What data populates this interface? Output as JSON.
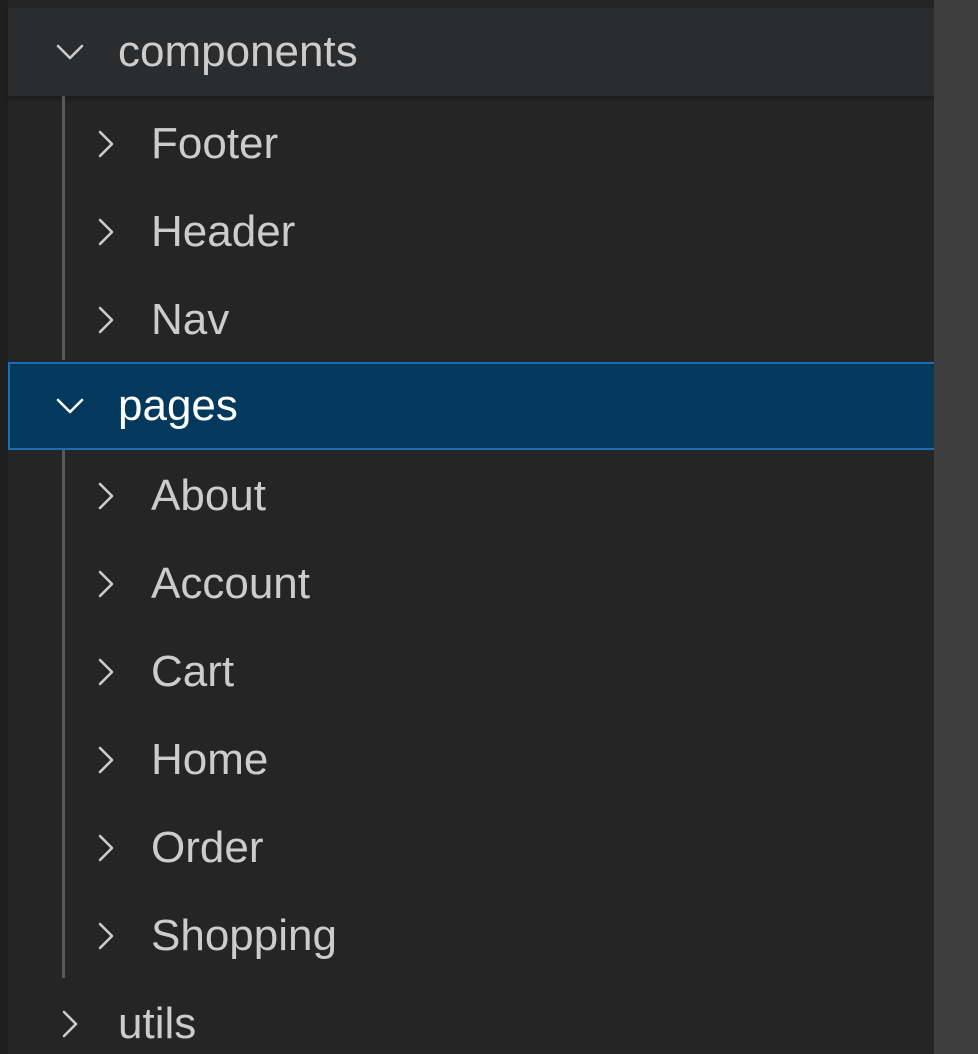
{
  "explorer": {
    "tree": [
      {
        "label": "components",
        "expanded": true,
        "level": 0,
        "children": [
          {
            "label": "Footer",
            "expanded": false
          },
          {
            "label": "Header",
            "expanded": false
          },
          {
            "label": "Nav",
            "expanded": false
          }
        ]
      },
      {
        "label": "pages",
        "expanded": true,
        "level": 0,
        "selected": true,
        "children": [
          {
            "label": "About",
            "expanded": false
          },
          {
            "label": "Account",
            "expanded": false
          },
          {
            "label": "Cart",
            "expanded": false
          },
          {
            "label": "Home",
            "expanded": false
          },
          {
            "label": "Order",
            "expanded": false
          },
          {
            "label": "Shopping",
            "expanded": false
          }
        ]
      },
      {
        "label": "utils",
        "expanded": false,
        "level": 0
      }
    ]
  },
  "colors": {
    "background": "#252526",
    "text": "#cccccc",
    "selection_background": "#04395e",
    "selection_border": "#1a6fb4",
    "indent_guide": "#585858"
  },
  "icons": {
    "expanded": "chevron-down-icon",
    "collapsed": "chevron-right-icon"
  }
}
